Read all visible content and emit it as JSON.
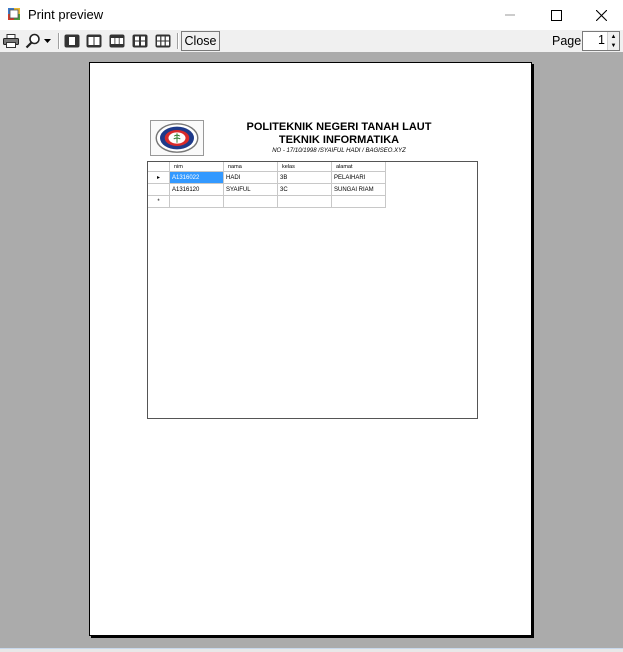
{
  "window": {
    "title": "Print preview",
    "minimize_glyph": "—",
    "maximize_glyph": "☐",
    "close_glyph": "✕"
  },
  "toolbar": {
    "close_label": "Close",
    "page_label": "Page",
    "page_value": "1",
    "spin_up_glyph": "▲",
    "spin_down_glyph": "▼"
  },
  "report": {
    "institution": "POLITEKNIK NEGERI TANAH LAUT",
    "department": "TEKNIK INFORMATIKA",
    "subtitle": "NO - 17/10/1998 /SYAIFUL HADI / BAGISEO.XYZ",
    "columns": [
      "nim",
      "nama",
      "kelas",
      "alamat"
    ],
    "rows": [
      [
        "A1316022",
        "HADI",
        "3B",
        "PELAIHARI"
      ],
      [
        "A1316120",
        "SYAIFUL",
        "3C",
        "SUNGAI RIAM"
      ]
    ],
    "current_row_marker": "▸",
    "new_row_marker": "*"
  },
  "colors": {
    "preview_background": "#ababab",
    "selection": "#3399ff"
  }
}
